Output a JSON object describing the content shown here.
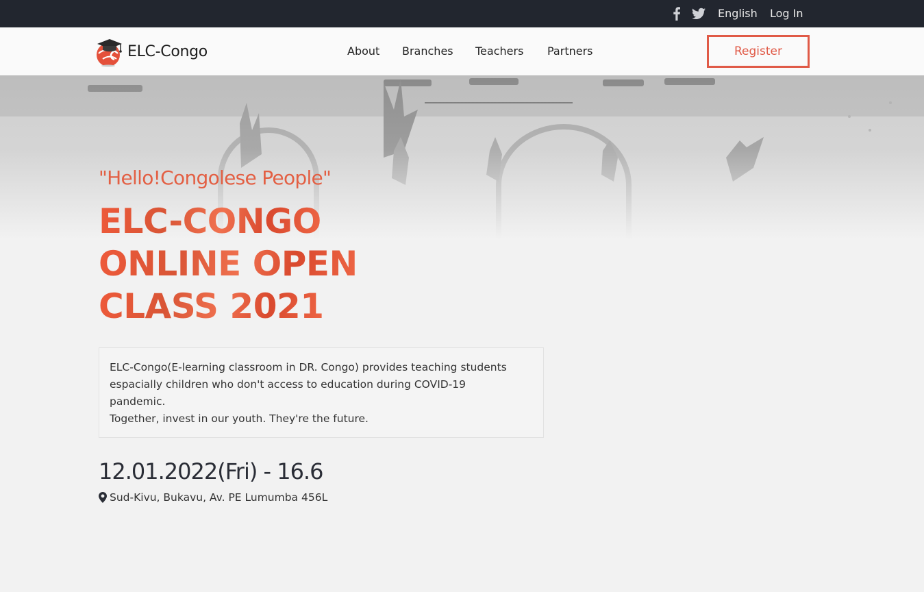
{
  "topbar": {
    "social_icons": [
      "facebook-icon",
      "twitter-icon"
    ],
    "language": "English",
    "login": "Log In"
  },
  "navbar": {
    "logo_text": "ELC-Congo",
    "logo_icon": "graduation-cap-globe-icon",
    "items": [
      "About",
      "Branches",
      "Teachers",
      "Partners"
    ],
    "register_label": "Register"
  },
  "hero": {
    "quote": "\"Hello!Congolese People\"",
    "title_lines": [
      "ELC-CONGO",
      "ONLINE OPEN",
      "CLASS 2021"
    ],
    "description": [
      "ELC-Congo(E-learning classroom in DR. Congo) provides teaching students",
      "espacially children who don't access to education during COVID-19",
      "pandemic.",
      "Together, invest in our youth. They're the future."
    ],
    "date": "12.01.2022(Fri) - 16.6",
    "location_icon": "map-marker-icon",
    "location": "Sud-Kivu, Bukavu, Av. PE Lumumba 456L"
  },
  "colors": {
    "topbar_bg": "#22262f",
    "accent": "#e05a47",
    "title_orange": "#e8563a",
    "page_bg": "#f2f2f2"
  }
}
